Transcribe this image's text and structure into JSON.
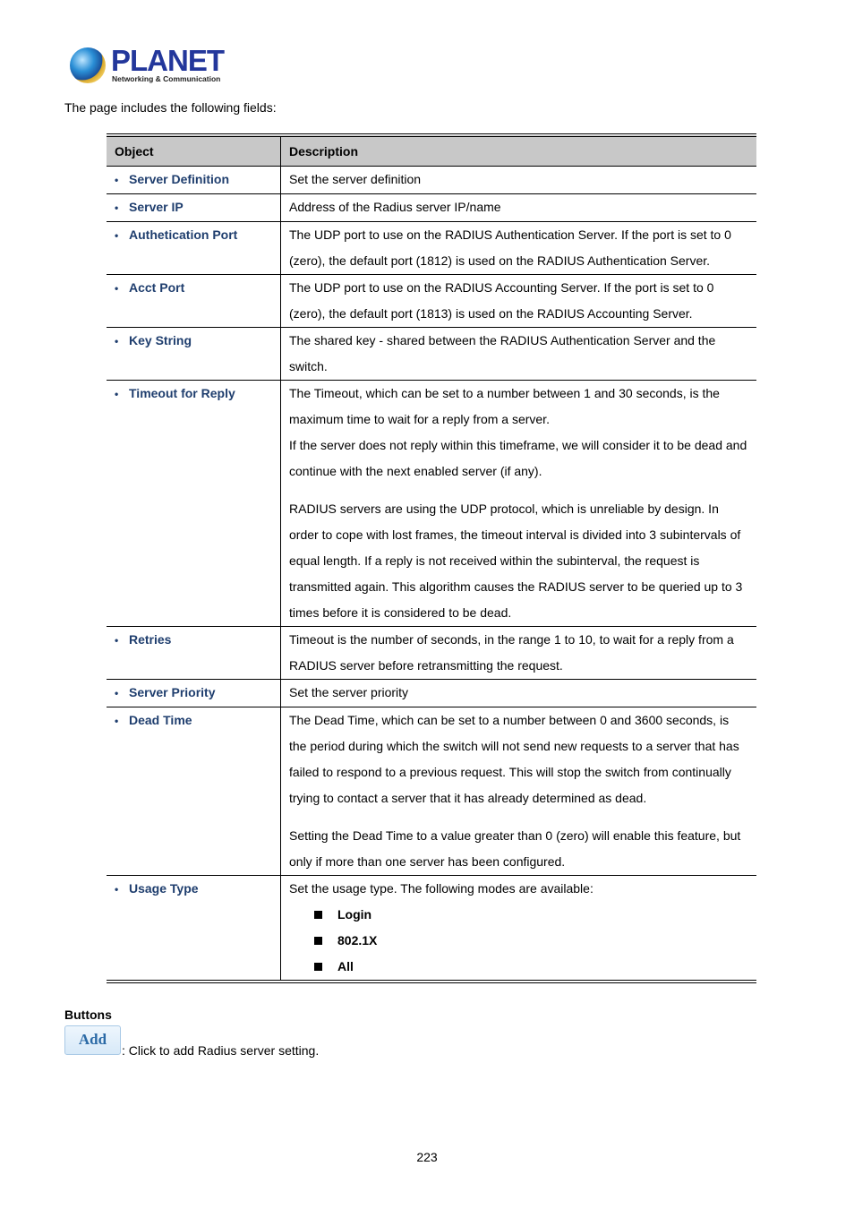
{
  "logo": {
    "brand": "PLANET",
    "tagline": "Networking & Communication"
  },
  "intro": "The page includes the following fields:",
  "table": {
    "headers": {
      "object": "Object",
      "description": "Description"
    },
    "rows": [
      {
        "object": "Server Definition",
        "description": [
          "Set the server definition"
        ]
      },
      {
        "object": "Server IP",
        "description": [
          "Address of the Radius server IP/name"
        ]
      },
      {
        "object": "Authetication Port",
        "description": [
          "The UDP port to use on the RADIUS Authentication Server. If the port is set to 0 (zero), the default port (1812) is used on the RADIUS Authentication Server."
        ]
      },
      {
        "object": "Acct Port",
        "description": [
          "The UDP port to use on the RADIUS Accounting Server. If the port is set to 0 (zero), the default port (1813) is used on the RADIUS Accounting Server."
        ]
      },
      {
        "object": "Key String",
        "description": [
          "The shared key - shared between the RADIUS Authentication Server and the switch."
        ]
      },
      {
        "object": "Timeout for Reply",
        "description": [
          "The Timeout, which can be set to a number between 1 and 30 seconds, is the maximum time to wait for a reply from a server.",
          "If the server does not reply within this timeframe, we will consider it to be dead and continue with the next enabled server (if any).",
          "RADIUS servers are using the UDP protocol, which is unreliable by design. In order to cope with lost frames, the timeout interval is divided into 3 subintervals of equal length. If a reply is not received within the subinterval, the request is transmitted again. This algorithm causes the RADIUS server to be queried up to 3 times before it is considered to be dead."
        ]
      },
      {
        "object": "Retries",
        "description": [
          "Timeout is the number of seconds, in the range 1 to 10, to wait for a reply from a RADIUS server before retransmitting the request."
        ]
      },
      {
        "object": "Server Priority",
        "description": [
          "Set the server priority"
        ]
      },
      {
        "object": "Dead Time",
        "description": [
          "The Dead Time, which can be set to a number between 0 and 3600 seconds, is the period during which the switch will not send new requests to a server that has failed to respond to a previous request. This will stop the switch from continually trying to contact a server that it has already determined as dead.",
          "Setting the Dead Time to a value greater than 0 (zero) will enable this feature, but only if more than one server has been configured."
        ]
      },
      {
        "object": "Usage Type",
        "description": [
          "Set the usage type. The following modes are available:"
        ],
        "modes": [
          "Login",
          "802.1X",
          "All"
        ]
      }
    ]
  },
  "buttons": {
    "heading": "Buttons",
    "add_label": "Add",
    "add_description": ": Click to add Radius server setting."
  },
  "page_number": "223"
}
